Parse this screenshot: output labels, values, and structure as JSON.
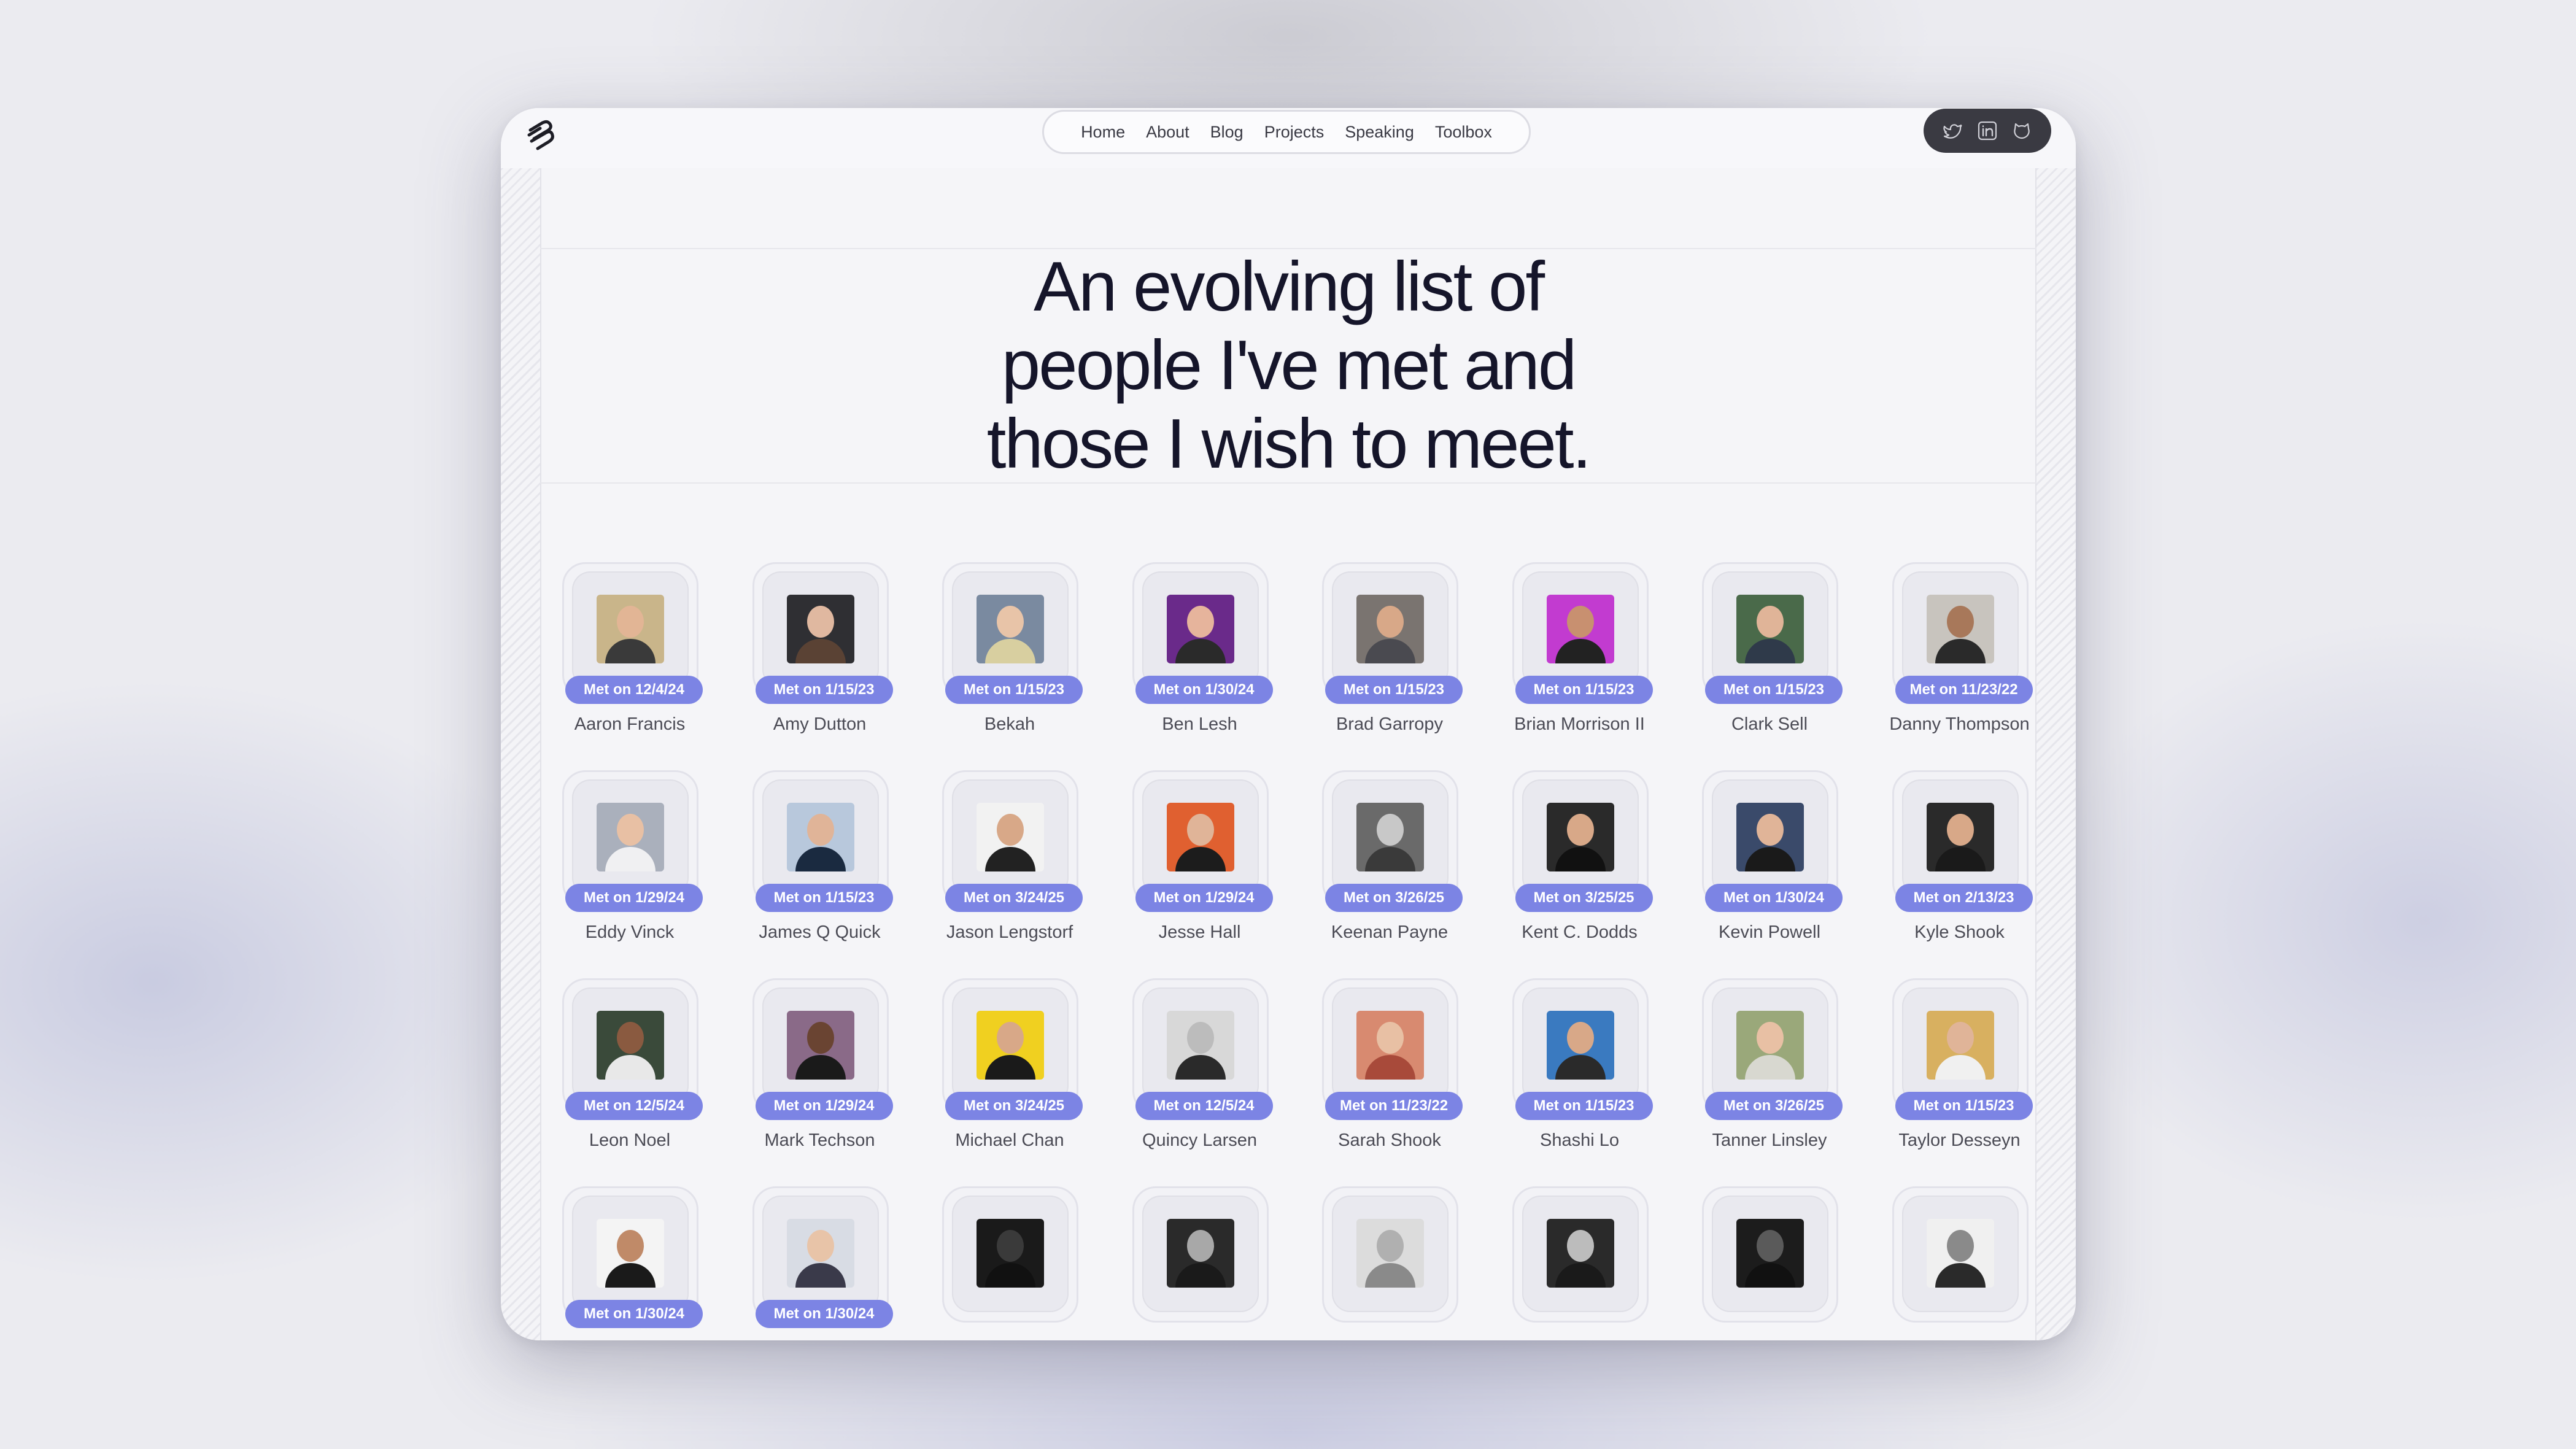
{
  "nav": {
    "links": [
      "Home",
      "About",
      "Blog",
      "Projects",
      "Speaking",
      "Toolbox"
    ]
  },
  "social": {
    "icons": [
      "twitter-icon",
      "linkedin-icon",
      "github-icon"
    ]
  },
  "hero": {
    "title": "An evolving list of\npeople I've met and\nthose I wish to meet."
  },
  "colors": {
    "badge": "#7c84e4",
    "title": "#15152a"
  },
  "people": [
    {
      "name": "Aaron Francis",
      "met": "Met on 12/4/24",
      "bg": "#c9b58a",
      "skin": "#e2b595",
      "shirt": "#3a3a3a"
    },
    {
      "name": "Amy Dutton",
      "met": "Met on 1/15/23",
      "bg": "#2f2f33",
      "skin": "#e0b8a0",
      "shirt": "#5a4234"
    },
    {
      "name": "Bekah",
      "met": "Met on 1/15/23",
      "bg": "#7a8aa0",
      "skin": "#e8c4a8",
      "shirt": "#d8cfa0"
    },
    {
      "name": "Ben Lesh",
      "met": "Met on 1/30/24",
      "bg": "#6a2a8a",
      "skin": "#e6b49c",
      "shirt": "#2a2a2a"
    },
    {
      "name": "Brad Garropy",
      "met": "Met on 1/15/23",
      "bg": "#7a7470",
      "skin": "#d8a888",
      "shirt": "#4a4a50"
    },
    {
      "name": "Brian Morrison II",
      "met": "Met on 1/15/23",
      "bg": "#c23bd0",
      "skin": "#c89070",
      "shirt": "#222222"
    },
    {
      "name": "Clark Sell",
      "met": "Met on 1/15/23",
      "bg": "#4a6a4a",
      "skin": "#e0b498",
      "shirt": "#2f3a4a"
    },
    {
      "name": "Danny Thompson",
      "met": "Met on 11/23/22",
      "bg": "#c8c4be",
      "skin": "#a8785a",
      "shirt": "#2a2a2a"
    },
    {
      "name": "Eddy Vinck",
      "met": "Met on 1/29/24",
      "bg": "#aab0bc",
      "skin": "#e8c0a4",
      "shirt": "#f0f0f2"
    },
    {
      "name": "James Q Quick",
      "met": "Met on 1/15/23",
      "bg": "#b8c8dc",
      "skin": "#e0b498",
      "shirt": "#1a2a40"
    },
    {
      "name": "Jason Lengstorf",
      "met": "Met on 3/24/25",
      "bg": "#f2f2f2",
      "skin": "#d8a888",
      "shirt": "#222222"
    },
    {
      "name": "Jesse Hall",
      "met": "Met on 1/29/24",
      "bg": "#e06030",
      "skin": "#e0b498",
      "shirt": "#1c1c1c"
    },
    {
      "name": "Keenan Payne",
      "met": "Met on 3/26/25",
      "bg": "#6a6a6a",
      "skin": "#c8c8c8",
      "shirt": "#3a3a3a"
    },
    {
      "name": "Kent C. Dodds",
      "met": "Met on 3/25/25",
      "bg": "#2a2a2a",
      "skin": "#d8a888",
      "shirt": "#111111"
    },
    {
      "name": "Kevin Powell",
      "met": "Met on 1/30/24",
      "bg": "#3a4a6a",
      "skin": "#e0b498",
      "shirt": "#1a1a1a"
    },
    {
      "name": "Kyle Shook",
      "met": "Met on 2/13/23",
      "bg": "#2a2a2a",
      "skin": "#d8a888",
      "shirt": "#1a1a1a"
    },
    {
      "name": "Leon Noel",
      "met": "Met on 12/5/24",
      "bg": "#3a4a3a",
      "skin": "#8a5a40",
      "shirt": "#e8e8e8"
    },
    {
      "name": "Mark Techson",
      "met": "Met on 1/29/24",
      "bg": "#8a6a88",
      "skin": "#6a4432",
      "shirt": "#1a1a1a"
    },
    {
      "name": "Michael Chan",
      "met": "Met on 3/24/25",
      "bg": "#f0d020",
      "skin": "#d8a888",
      "shirt": "#1a1a1a"
    },
    {
      "name": "Quincy Larsen",
      "met": "Met on 12/5/24",
      "bg": "#d8d8d8",
      "skin": "#bcbcbc",
      "shirt": "#2a2a2a"
    },
    {
      "name": "Sarah Shook",
      "met": "Met on 11/23/22",
      "bg": "#d88a70",
      "skin": "#e8c0a4",
      "shirt": "#a84a3a"
    },
    {
      "name": "Shashi Lo",
      "met": "Met on 1/15/23",
      "bg": "#3a7ac0",
      "skin": "#d8a888",
      "shirt": "#2a2a2a"
    },
    {
      "name": "Tanner Linsley",
      "met": "Met on 3/26/25",
      "bg": "#9aa87a",
      "skin": "#e8c0a4",
      "shirt": "#d8d8d0"
    },
    {
      "name": "Taylor Desseyn",
      "met": "Met on 1/15/23",
      "bg": "#d8b060",
      "skin": "#e0b498",
      "shirt": "#f0f0f0"
    },
    {
      "name": "",
      "met": "Met on 1/30/24",
      "bg": "#f4f4f4",
      "skin": "#c08a68",
      "shirt": "#1a1a1a"
    },
    {
      "name": "",
      "met": "Met on 1/30/24",
      "bg": "#d8dce4",
      "skin": "#e8c4a8",
      "shirt": "#3a3a4a"
    },
    {
      "name": "",
      "met": "",
      "bg": "#1a1a1a",
      "skin": "#3a3a3a",
      "shirt": "#111111"
    },
    {
      "name": "",
      "met": "",
      "bg": "#2a2a2a",
      "skin": "#a8a8a8",
      "shirt": "#1a1a1a"
    },
    {
      "name": "",
      "met": "",
      "bg": "#dcdcdc",
      "skin": "#b0b0b0",
      "shirt": "#8a8a8a"
    },
    {
      "name": "",
      "met": "",
      "bg": "#2a2a2a",
      "skin": "#bcbcbc",
      "shirt": "#1a1a1a"
    },
    {
      "name": "",
      "met": "",
      "bg": "#1c1c1c",
      "skin": "#5a5a5a",
      "shirt": "#111111"
    },
    {
      "name": "",
      "met": "",
      "bg": "#f0f0f0",
      "skin": "#8a8a8a",
      "shirt": "#2a2a2a"
    }
  ]
}
